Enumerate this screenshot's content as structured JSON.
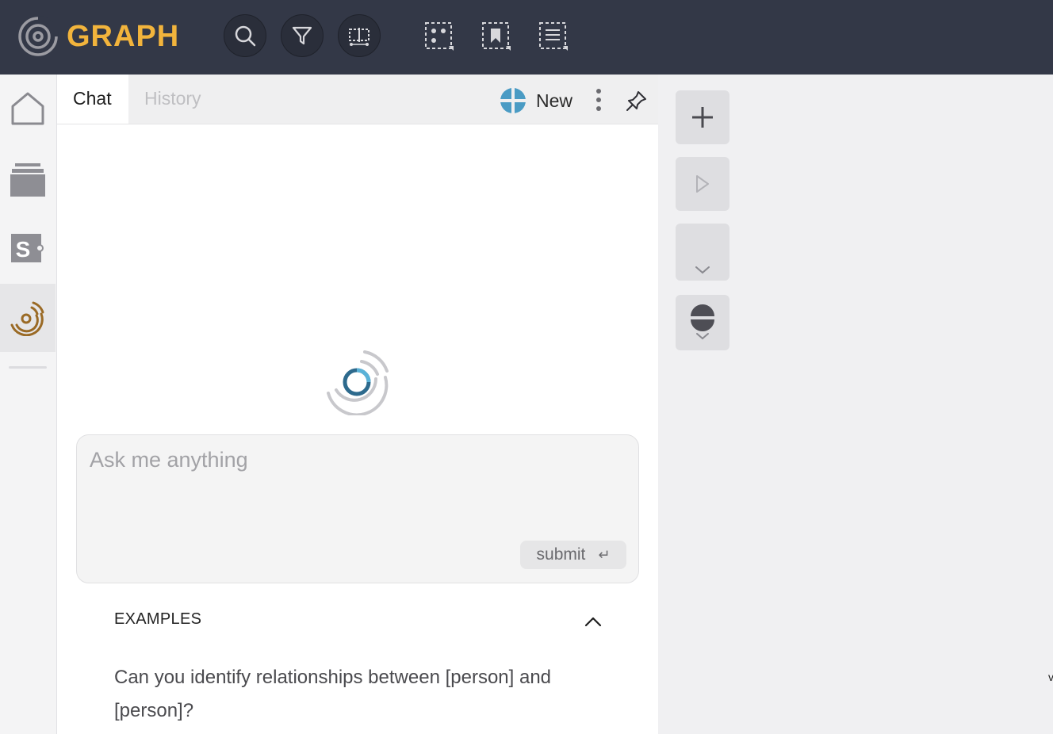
{
  "app": {
    "title": "GRAPH",
    "accent": "#f2b43c"
  },
  "toolbar": {
    "buttons": [
      {
        "icon": "search-icon"
      },
      {
        "icon": "filter-icon"
      },
      {
        "icon": "layout-icon"
      },
      {
        "icon": "select-nodes-icon"
      },
      {
        "icon": "bookmark-select-icon"
      },
      {
        "icon": "list-select-icon"
      }
    ]
  },
  "sidebar": {
    "items": [
      {
        "icon": "home-icon"
      },
      {
        "icon": "stack-icon"
      },
      {
        "icon": "s-plugin-icon",
        "glyph": "S"
      },
      {
        "icon": "ai-assistant-icon",
        "active": true
      }
    ]
  },
  "panel": {
    "tabs": [
      {
        "label": "Chat",
        "active": true
      },
      {
        "label": "History",
        "active": false
      }
    ],
    "new_label": "New",
    "input": {
      "placeholder": "Ask me anything",
      "value": ""
    },
    "submit_label": "submit",
    "submit_key": "↵",
    "examples_heading": "EXAMPLES",
    "examples": [
      "Can you identify relationships between [person] and [person]?"
    ]
  },
  "right_tools": [
    {
      "icon": "plus-icon"
    },
    {
      "icon": "play-icon"
    },
    {
      "icon": "collapse-icon"
    },
    {
      "icon": "half-circle-icon"
    }
  ],
  "edge_mark": "v"
}
